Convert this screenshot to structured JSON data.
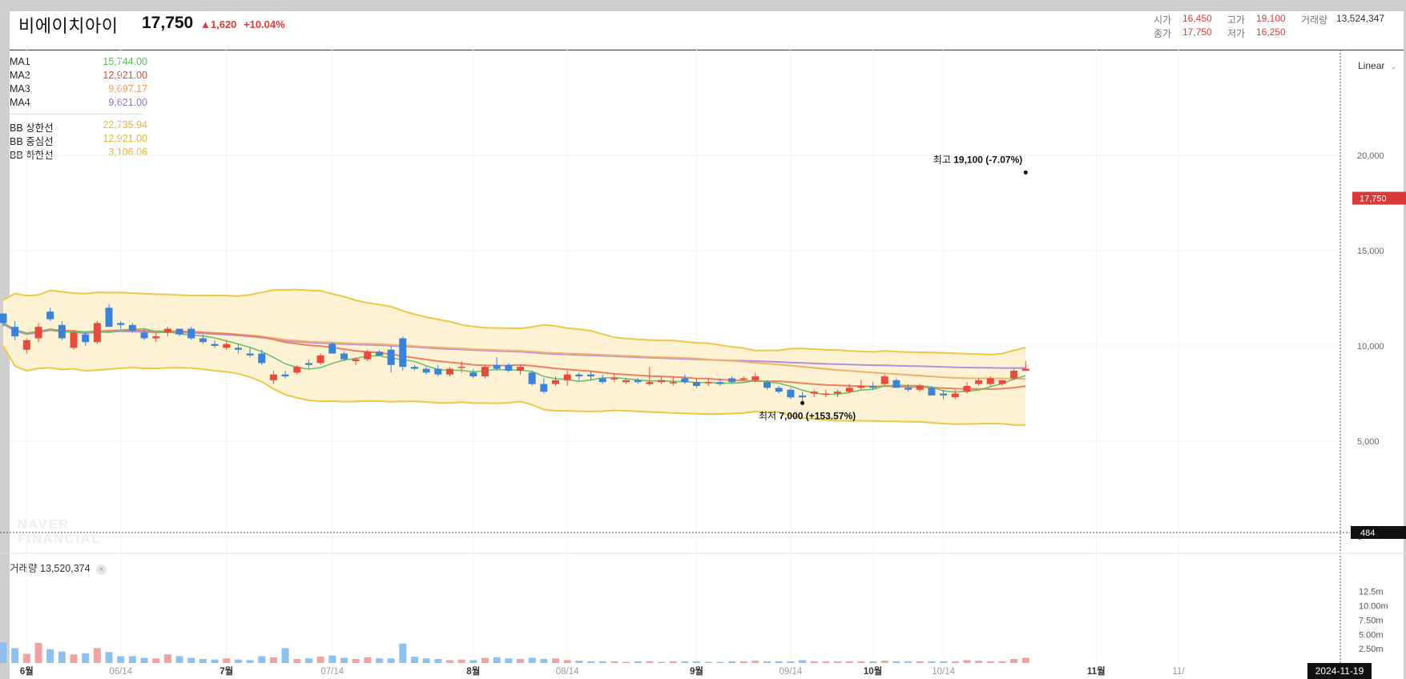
{
  "header": {
    "name": "비에이치아이",
    "price": "17,750",
    "change": "▲1,620",
    "change_pct": "+10.04%",
    "open_label": "시가",
    "open": "16,450",
    "high_label": "고가",
    "high": "19,100",
    "volume_label": "거래량",
    "volume": "13,524,347",
    "close_label": "종가",
    "close": "17,750",
    "low_label": "저가",
    "low": "16,250"
  },
  "legend": {
    "ma": [
      {
        "name": "MA1",
        "value": "15,744.00",
        "color": "#5cb85c"
      },
      {
        "name": "MA2",
        "value": "12,921.00",
        "color": "#e04a3a"
      },
      {
        "name": "MA3",
        "value": "9,697.17",
        "color": "#f0a060"
      },
      {
        "name": "MA4",
        "value": "9,621.00",
        "color": "#9b6fd0"
      }
    ],
    "bb": [
      {
        "name": "BB 상한선",
        "value": "22,735.94",
        "color": "#e8b830"
      },
      {
        "name": "BB 중심선",
        "value": "12,921.00",
        "color": "#e8b830"
      },
      {
        "name": "BB 하한선",
        "value": "3,106.06",
        "color": "#e8b830"
      }
    ]
  },
  "scale_label": "Linear",
  "watermark": [
    "NAVER",
    "FINANCIAL"
  ],
  "crosshair_value": "484",
  "date_tag": "2024-11-19",
  "volume_panel": {
    "label": "거래량",
    "value": "13,520,374"
  },
  "annotations": {
    "max_label": "최고",
    "max_value": "19,100",
    "max_pct": "(-7.07%)",
    "min_label": "최저",
    "min_value": "7,000",
    "min_pct": "(+153.57%)"
  },
  "colors": {
    "up": "#e84a3c",
    "down": "#3c82d8",
    "vol_up": "#f2a1a1",
    "vol_down": "#8ec0f0",
    "band": "#e8c840",
    "band_fill": "#fdf3d4"
  },
  "chart_data": {
    "type": "candlestick",
    "price_axis_ticks": [
      "0",
      "5,000",
      "10,000",
      "15,000",
      "20,000"
    ],
    "price_range": [
      0,
      25000
    ],
    "volume_axis_ticks": [
      "2.50m",
      "5.00m",
      "7.50m",
      "10.00m",
      "12.5m"
    ],
    "volume_range": [
      0,
      14000000
    ],
    "last_price_tag": "17,750",
    "x_labels": [
      {
        "i": 2,
        "label": "6월"
      },
      {
        "i": 10,
        "label": "06/14"
      },
      {
        "i": 19,
        "label": "7월"
      },
      {
        "i": 28,
        "label": "07/14"
      },
      {
        "i": 40,
        "label": "8월"
      },
      {
        "i": 48,
        "label": "08/14"
      },
      {
        "i": 59,
        "label": "9월"
      },
      {
        "i": 67,
        "label": "09/14"
      },
      {
        "i": 74,
        "label": "10월"
      },
      {
        "i": 80,
        "label": "10/14"
      },
      {
        "i": 93,
        "label": "11월"
      },
      {
        "i": 100,
        "label": "11/"
      }
    ],
    "candles": [
      [
        11700,
        11700,
        11000,
        11200,
        3600000
      ],
      [
        11000,
        11300,
        10300,
        10500,
        2600000
      ],
      [
        9800,
        10400,
        9600,
        10300,
        1600000
      ],
      [
        10400,
        11200,
        10200,
        11000,
        3500000
      ],
      [
        11800,
        12000,
        11300,
        11400,
        2400000
      ],
      [
        11100,
        11300,
        10300,
        10400,
        2000000
      ],
      [
        9900,
        10800,
        9800,
        10700,
        1500000
      ],
      [
        10600,
        10700,
        10000,
        10200,
        1700000
      ],
      [
        10200,
        11300,
        10100,
        11200,
        2600000
      ],
      [
        12000,
        12200,
        11000,
        11000,
        1900000
      ],
      [
        11200,
        11300,
        10900,
        11100,
        1200000
      ],
      [
        11100,
        11200,
        10700,
        10800,
        1200000
      ],
      [
        10700,
        10900,
        10300,
        10400,
        900000
      ],
      [
        10400,
        10700,
        10200,
        10500,
        800000
      ],
      [
        10700,
        11000,
        10500,
        10900,
        1500000
      ],
      [
        10900,
        10900,
        10500,
        10600,
        1200000
      ],
      [
        10900,
        11000,
        10300,
        10400,
        900000
      ],
      [
        10400,
        10600,
        10100,
        10200,
        700000
      ],
      [
        10100,
        10300,
        9900,
        10000,
        600000
      ],
      [
        9900,
        10300,
        9800,
        10100,
        800000
      ],
      [
        9900,
        10100,
        9600,
        9800,
        600000
      ],
      [
        9600,
        9900,
        9400,
        9500,
        500000
      ],
      [
        9600,
        9800,
        9000,
        9100,
        1200000
      ],
      [
        8200,
        8700,
        8000,
        8500,
        1000000
      ],
      [
        8500,
        8700,
        8300,
        8400,
        2600000
      ],
      [
        8600,
        9000,
        8500,
        8900,
        700000
      ],
      [
        9100,
        9300,
        8800,
        9000,
        800000
      ],
      [
        9100,
        9600,
        9000,
        9500,
        1100000
      ],
      [
        10100,
        10200,
        9600,
        9600,
        1300000
      ],
      [
        9600,
        9700,
        9200,
        9300,
        900000
      ],
      [
        9200,
        9400,
        9000,
        9300,
        700000
      ],
      [
        9300,
        9800,
        9200,
        9700,
        1000000
      ],
      [
        9700,
        9800,
        9500,
        9500,
        800000
      ],
      [
        9800,
        10000,
        8600,
        9000,
        800000
      ],
      [
        10400,
        10500,
        8700,
        8900,
        3400000
      ],
      [
        8900,
        9000,
        8700,
        8800,
        1100000
      ],
      [
        8800,
        8900,
        8500,
        8600,
        800000
      ],
      [
        8800,
        9000,
        8400,
        8500,
        700000
      ],
      [
        8500,
        8900,
        8400,
        8800,
        500000
      ],
      [
        8900,
        9200,
        8600,
        8900,
        600000
      ],
      [
        8600,
        8800,
        8300,
        8400,
        500000
      ],
      [
        8400,
        9000,
        8300,
        8900,
        900000
      ],
      [
        9000,
        9400,
        8700,
        8800,
        1000000
      ],
      [
        9000,
        9100,
        8600,
        8700,
        800000
      ],
      [
        8700,
        9000,
        8500,
        8900,
        700000
      ],
      [
        8600,
        8700,
        7900,
        8000,
        900000
      ],
      [
        8000,
        8300,
        7500,
        7600,
        700000
      ],
      [
        8000,
        8400,
        7900,
        8200,
        800000
      ],
      [
        8200,
        8700,
        7900,
        8500,
        500000
      ],
      [
        8500,
        8600,
        8200,
        8400,
        400000
      ],
      [
        8500,
        8700,
        8200,
        8400,
        300000
      ],
      [
        8300,
        8500,
        8000,
        8100,
        300000
      ],
      [
        8300,
        8500,
        8100,
        8300,
        300000
      ],
      [
        8100,
        8300,
        8000,
        8200,
        200000
      ],
      [
        8200,
        8300,
        8000,
        8100,
        300000
      ],
      [
        8000,
        8900,
        7900,
        8100,
        300000
      ],
      [
        8100,
        8400,
        8000,
        8200,
        200000
      ],
      [
        8100,
        8400,
        7900,
        8100,
        300000
      ],
      [
        8300,
        8500,
        8000,
        8100,
        300000
      ],
      [
        8100,
        8300,
        7800,
        7900,
        300000
      ],
      [
        8100,
        8300,
        7900,
        8100,
        200000
      ],
      [
        8100,
        8300,
        7900,
        8000,
        200000
      ],
      [
        8300,
        8400,
        8000,
        8100,
        300000
      ],
      [
        8300,
        8400,
        8200,
        8300,
        300000
      ],
      [
        8200,
        8600,
        8100,
        8400,
        400000
      ],
      [
        8100,
        8200,
        7700,
        7800,
        300000
      ],
      [
        7800,
        7900,
        7500,
        7600,
        300000
      ],
      [
        7700,
        7800,
        7200,
        7300,
        300000
      ],
      [
        7400,
        7600,
        7000,
        7300,
        500000
      ],
      [
        7500,
        7700,
        7300,
        7600,
        300000
      ],
      [
        7500,
        7700,
        7300,
        7500,
        300000
      ],
      [
        7500,
        7700,
        7300,
        7600,
        300000
      ],
      [
        7600,
        8000,
        7500,
        7800,
        300000
      ],
      [
        7800,
        8200,
        7700,
        7900,
        300000
      ],
      [
        7900,
        8100,
        7700,
        7800,
        300000
      ],
      [
        8000,
        8500,
        7900,
        8400,
        400000
      ],
      [
        8200,
        8300,
        7800,
        7800,
        300000
      ],
      [
        7800,
        8000,
        7600,
        7700,
        300000
      ],
      [
        7700,
        8000,
        7600,
        7900,
        300000
      ],
      [
        7800,
        7900,
        7400,
        7400,
        300000
      ],
      [
        7500,
        7700,
        7200,
        7400,
        300000
      ],
      [
        7300,
        7700,
        7200,
        7500,
        300000
      ],
      [
        7600,
        8100,
        7500,
        7900,
        500000
      ],
      [
        8000,
        8300,
        7900,
        8200,
        400000
      ],
      [
        8000,
        8400,
        7900,
        8300,
        300000
      ],
      [
        8000,
        8200,
        7900,
        8200,
        300000
      ],
      [
        8300,
        8800,
        8200,
        8700,
        700000
      ],
      [
        8700,
        9200,
        8700,
        8800,
        900000
      ]
    ]
  }
}
